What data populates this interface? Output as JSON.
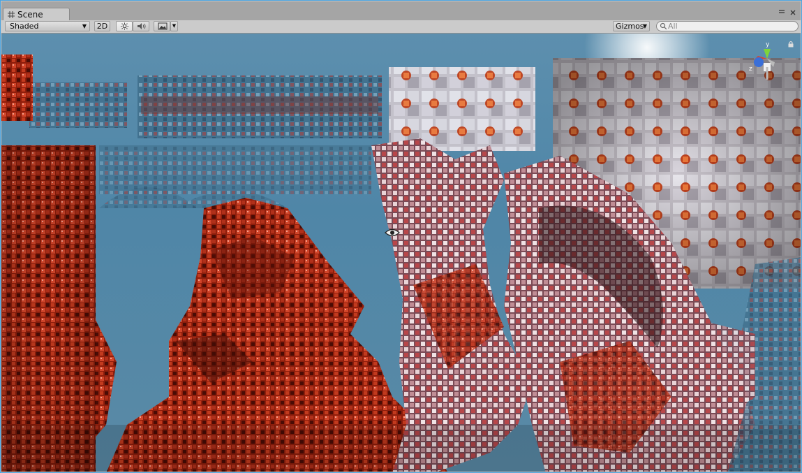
{
  "window": {
    "tab_label": "Scene",
    "tab_icon": "grid-icon"
  },
  "toolbar": {
    "draw_mode": "Shaded",
    "btn_2d": "2D",
    "gizmos_label": "Gizmos",
    "search_placeholder": "All",
    "icons": [
      "sun-icon",
      "speaker-icon",
      "image-icon"
    ]
  },
  "scene": {
    "gizmo_axis_label_y": "y",
    "gizmo_axis_label_z": "z",
    "colors": {
      "sky": "#5b8eae",
      "fractal_red": "#c23a1e",
      "fractal_dark": "#5a1208",
      "fractal_light": "#e8d0d0",
      "axis_y": "#7fd43a",
      "axis_x": "#d9442e",
      "axis_z": "#3a6fd8"
    }
  }
}
